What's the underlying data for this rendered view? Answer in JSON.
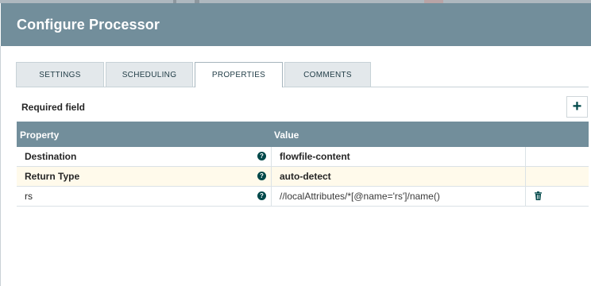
{
  "dialog": {
    "title": "Configure Processor"
  },
  "tabs": [
    {
      "label": "SETTINGS",
      "active": false
    },
    {
      "label": "SCHEDULING",
      "active": false
    },
    {
      "label": "PROPERTIES",
      "active": true
    },
    {
      "label": "COMMENTS",
      "active": false
    }
  ],
  "properties": {
    "required_label": "Required field",
    "add_icon": "plus-icon",
    "columns": {
      "property": "Property",
      "value": "Value"
    },
    "rows": [
      {
        "name": "Destination",
        "required": true,
        "value": "flowfile-content",
        "deletable": false
      },
      {
        "name": "Return Type",
        "required": true,
        "value": "auto-detect",
        "deletable": false
      },
      {
        "name": "rs",
        "required": false,
        "value": "//localAttributes/*[@name='rs']/name()",
        "deletable": true
      }
    ],
    "help_icon": "question-circle-icon",
    "delete_icon": "trash-icon"
  },
  "colors": {
    "header": "#728e9b",
    "accent": "#004849",
    "highlight_row": "#fffaeb"
  }
}
